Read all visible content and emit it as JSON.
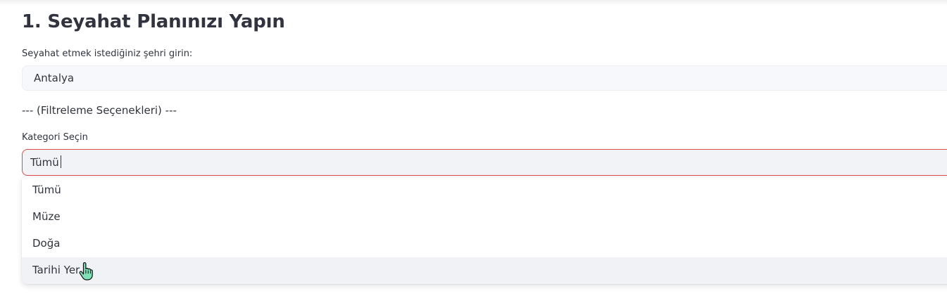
{
  "section": {
    "title": "1. Seyahat Planınızı Yapın"
  },
  "city_input": {
    "label": "Seyahat etmek istediğiniz şehri girin:",
    "value": "Antalya"
  },
  "filter_heading": "--- (Filtreleme Seçenekleri) ---",
  "category_select": {
    "label": "Kategori Seçin",
    "value": "Tümü",
    "options": [
      {
        "label": "Tümü"
      },
      {
        "label": "Müze"
      },
      {
        "label": "Doğa"
      },
      {
        "label": "Tarihi Yer"
      }
    ],
    "hovered_option": "Tarihi Yer",
    "accent_color": "#e24a4a"
  },
  "cursor": {
    "icon": "hand-pointer-icon"
  }
}
